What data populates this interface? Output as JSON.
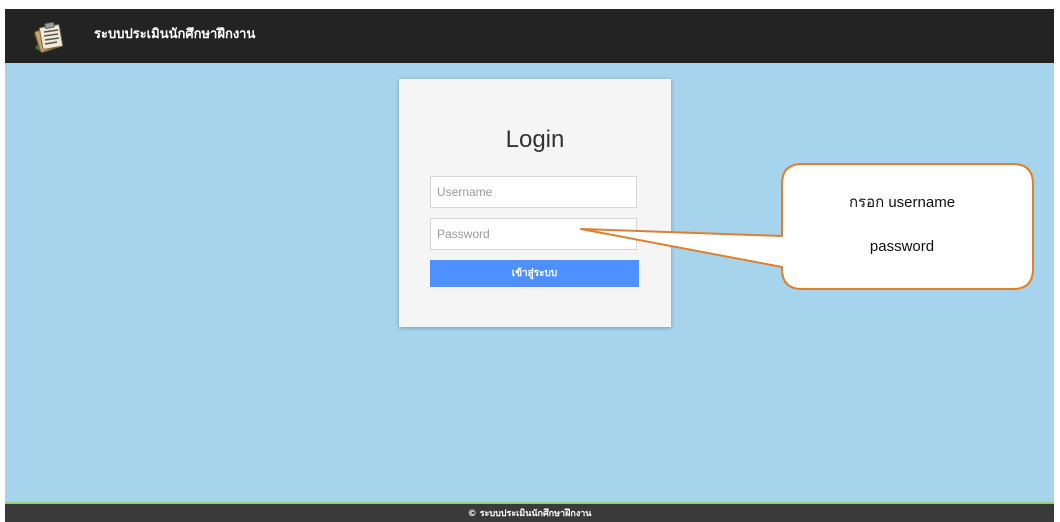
{
  "navbar": {
    "brand": "ระบบประเมินนักศึกษาฝึกงาน",
    "logo_icon": "clipboard-document-icon"
  },
  "login": {
    "title": "Login",
    "username_placeholder": "Username",
    "password_placeholder": "Password",
    "submit_label": "เข้าสู่ระบบ"
  },
  "callout": {
    "line1": "กรอก username",
    "line2": "password",
    "border_color": "#e07f2c"
  },
  "footer": {
    "text": "© ระบบประเมินนักศึกษาฝึกงาน"
  },
  "colors": {
    "page_background": "#a6d4ec",
    "navbar": "#232323",
    "button": "#4d90fe",
    "footer_accent": "#8fd16b"
  }
}
